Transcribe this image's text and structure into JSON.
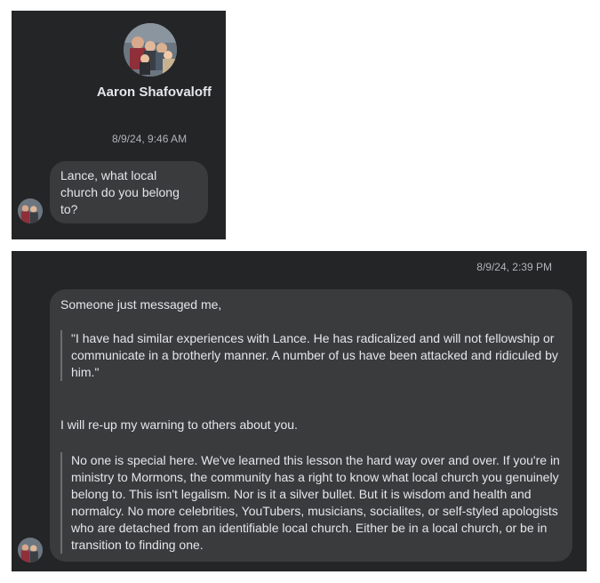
{
  "conversation": [
    {
      "profile": {
        "name": "Aaron Shafovaloff",
        "avatar": "family-photo-avatar"
      },
      "timestamp": "8/9/24, 9:46 AM",
      "message": {
        "text": "Lance, what local church do you belong to?"
      }
    },
    {
      "timestamp": "8/9/24, 2:39 PM",
      "message": {
        "intro": "Someone just messaged me,",
        "quote1": "\"I have had similar experiences with Lance. He has radicalized and will not fellowship or communicate in a brotherly manner. A number of us have been attacked and ridiculed by him.\"",
        "line2": "I will re-up my warning to others about you.",
        "quote2": "No one is special here. We've learned this lesson the hard way over and over. If you're in ministry to Mormons, the community has a right to know what local church you genuinely belong to. This isn't legalism. Nor is it a silver bullet. But it is wisdom and health and normalcy. No more celebrities, YouTubers, musicians, socialites, or self-styled apologists who are detached from an identifiable local church. Either be in a local church, or be in transition to finding one."
      }
    }
  ],
  "colors": {
    "panel": "#242526",
    "bubble": "#3a3b3c",
    "text": "#e4e6eb",
    "muted": "#b0b3b8"
  }
}
